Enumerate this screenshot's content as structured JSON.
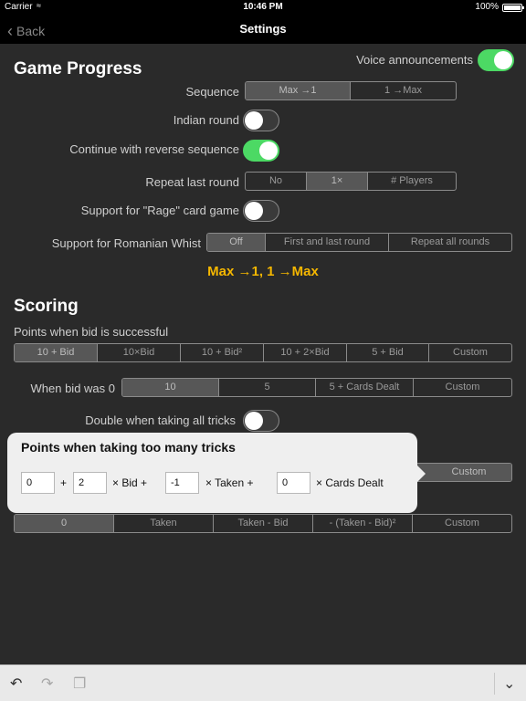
{
  "status": {
    "carrier": "Carrier",
    "time": "10:46 PM",
    "battery": "100%"
  },
  "nav": {
    "back_label": "Back",
    "title": "Settings"
  },
  "voice": {
    "label": "Voice announcements",
    "on": true
  },
  "game_progress": {
    "heading": "Game Progress",
    "sequence": {
      "label": "Sequence",
      "options": [
        "Max →1",
        "1 →Max"
      ],
      "selected": 0
    },
    "indian_round": {
      "label": "Indian round",
      "on": false
    },
    "continue_reverse": {
      "label": "Continue with reverse sequence",
      "on": true
    },
    "repeat_last": {
      "label": "Repeat last round",
      "options": [
        "No",
        "1×",
        "# Players"
      ],
      "selected": 1
    },
    "rage": {
      "label": "Support for \"Rage\" card game",
      "on": false
    },
    "romanian": {
      "label": "Support for Romanian Whist",
      "options": [
        "Off",
        "First and last round",
        "Repeat all rounds"
      ],
      "selected": 0
    },
    "summary": "Max →1, 1 →Max"
  },
  "scoring": {
    "heading": "Scoring",
    "bid_success": {
      "label": "Points when bid is successful",
      "options": [
        "10 + Bid",
        "10×Bid",
        "10 + Bid²",
        "10 + 2×Bid",
        "5 + Bid",
        "Custom"
      ],
      "selected": 0
    },
    "bid_zero": {
      "label": "When bid was 0",
      "options": [
        "10",
        "5",
        "5 + Cards Dealt",
        "Custom"
      ],
      "selected": 0
    },
    "double_all": {
      "label": "Double when taking all tricks",
      "on": false
    },
    "too_many_partial": {
      "options": [
        "Custom"
      ],
      "selected": 0
    },
    "too_few": {
      "options": [
        "0",
        "Taken",
        "Taken - Bid",
        "- (Taken - Bid)²",
        "Custom"
      ],
      "selected": 0
    }
  },
  "popover": {
    "title": "Points when taking too many tricks",
    "a": "0",
    "plus": "+",
    "b": "2",
    "bid_text": "× Bid +",
    "c": "-1",
    "taken_text": "× Taken +",
    "d": "0",
    "dealt_text": "× Cards Dealt"
  },
  "toolbar": {
    "undo": "undo-icon",
    "redo": "redo-icon",
    "paste": "paste-icon",
    "collapse": "chevron-down-icon"
  }
}
